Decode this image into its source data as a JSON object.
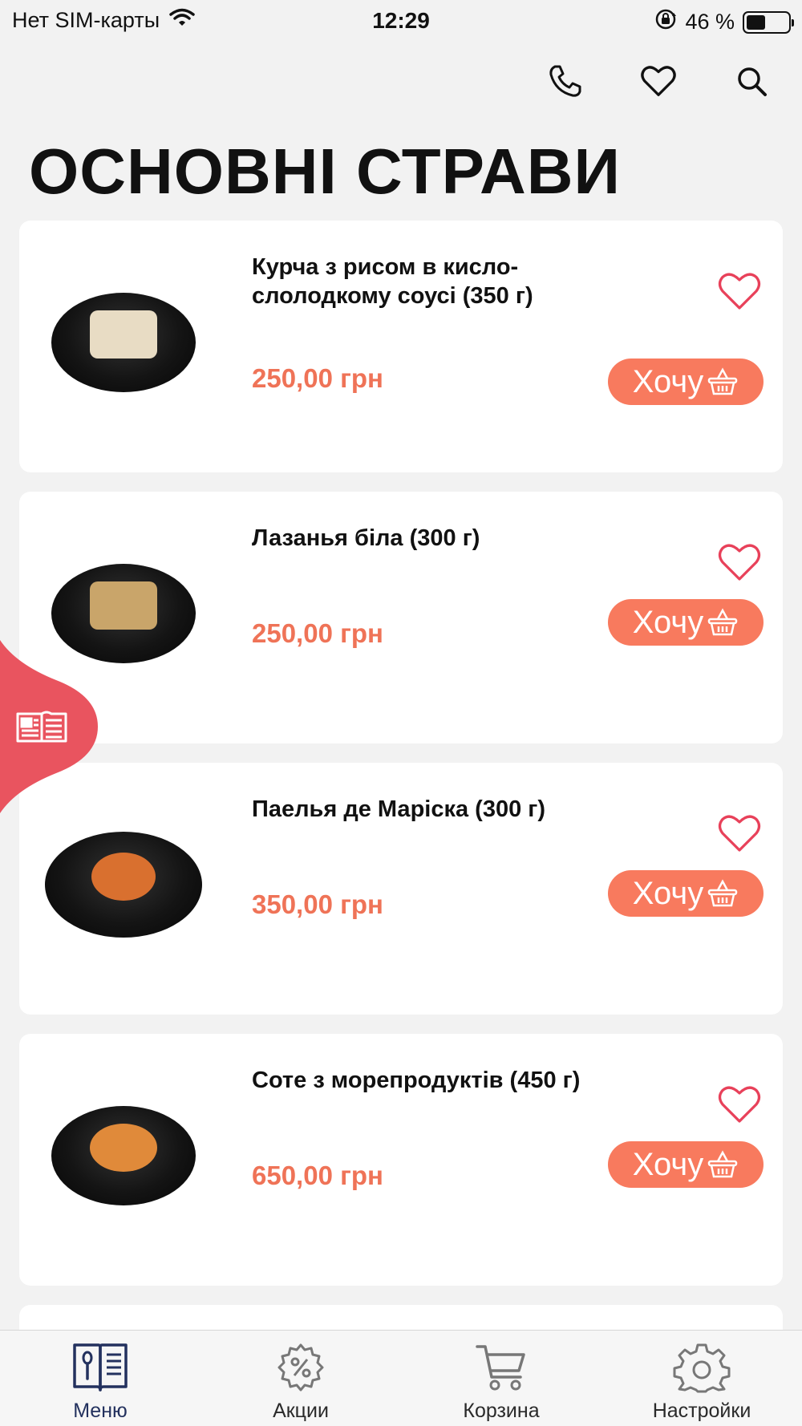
{
  "status_bar": {
    "carrier": "Нет SIM-карты",
    "time": "12:29",
    "battery_text": "46 %",
    "battery_level": 0.46
  },
  "header": {
    "title": "ОСНОВНІ СТРАВИ"
  },
  "items": [
    {
      "title": "Курча з рисом в кисло-слолодкому соусі (350 г)",
      "price": "250,00 грн",
      "button": "Хочу",
      "food_color": "#e8dcc4"
    },
    {
      "title": "Лазанья біла (300 г)",
      "price": "250,00 грн",
      "button": "Хочу",
      "food_color": "#c9a56a"
    },
    {
      "title": "Паелья де Маріска (300 г)",
      "price": "350,00 грн",
      "button": "Хочу",
      "food_color": "#d9702f"
    },
    {
      "title": "Соте з морепродуктів (450 г)",
      "price": "650,00 грн",
      "button": "Хочу",
      "food_color": "#e08a3a"
    }
  ],
  "tabs": [
    {
      "label": "Меню",
      "icon": "menu-book-icon",
      "active": true
    },
    {
      "label": "Акции",
      "icon": "percent-gear-icon",
      "active": false
    },
    {
      "label": "Корзина",
      "icon": "cart-icon",
      "active": false
    },
    {
      "label": "Настройки",
      "icon": "settings-gear-icon",
      "active": false
    }
  ],
  "colors": {
    "accent": "#f87a5e",
    "price": "#ef7357",
    "heart": "#e8415a",
    "side_tab": "#e9545f",
    "active_tab": "#23315e"
  }
}
